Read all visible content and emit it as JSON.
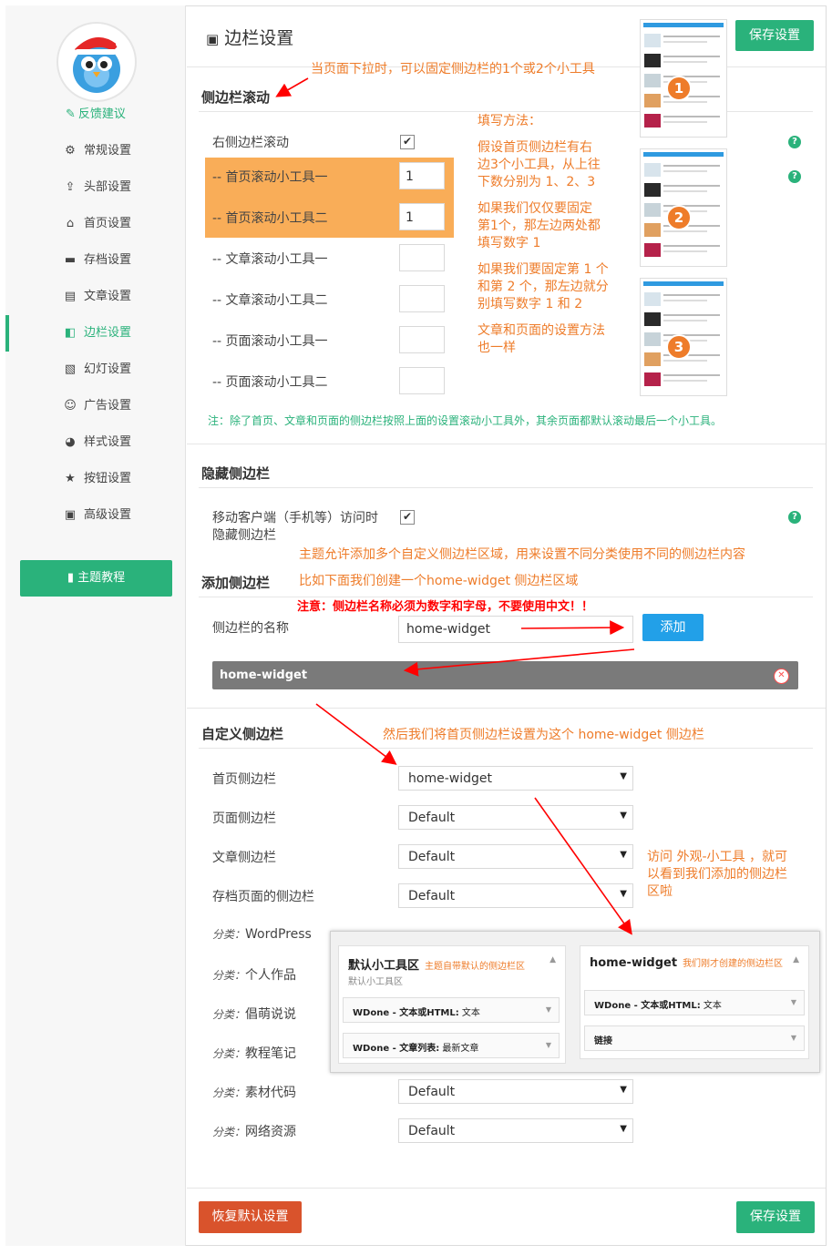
{
  "sidebar": {
    "feedback": "反馈建议",
    "items": [
      {
        "label": "常规设置",
        "icon": "gear-icon",
        "glyph": "⚙"
      },
      {
        "label": "头部设置",
        "icon": "upload-icon",
        "glyph": "⇪"
      },
      {
        "label": "首页设置",
        "icon": "home-icon",
        "glyph": "⌂"
      },
      {
        "label": "存档设置",
        "icon": "folder-icon",
        "glyph": "▬"
      },
      {
        "label": "文章设置",
        "icon": "article-icon",
        "glyph": "▤"
      },
      {
        "label": "边栏设置",
        "icon": "sidebar-icon",
        "glyph": "◧",
        "active": true
      },
      {
        "label": "幻灯设置",
        "icon": "picture-icon",
        "glyph": "▧"
      },
      {
        "label": "广告设置",
        "icon": "smile-icon",
        "glyph": "☺"
      },
      {
        "label": "样式设置",
        "icon": "palette-icon",
        "glyph": "◕"
      },
      {
        "label": "按钮设置",
        "icon": "star-icon",
        "glyph": "★"
      },
      {
        "label": "高级设置",
        "icon": "tools-icon",
        "glyph": "▣"
      }
    ],
    "tutorial": "主题教程"
  },
  "header": {
    "title": "边栏设置",
    "save_top": "保存设置"
  },
  "scroll": {
    "title": "侧边栏滚动",
    "right_label": "右侧边栏滚动",
    "rows": [
      {
        "label": "-- 首页滚动小工具一",
        "value": "1"
      },
      {
        "label": "-- 首页滚动小工具二",
        "value": "1"
      },
      {
        "label": "-- 文章滚动小工具一",
        "value": ""
      },
      {
        "label": "-- 文章滚动小工具二",
        "value": ""
      },
      {
        "label": "-- 页面滚动小工具一",
        "value": ""
      },
      {
        "label": "-- 页面滚动小工具二",
        "value": ""
      }
    ],
    "note": "注：除了首页、文章和页面的侧边栏按照上面的设置滚动小工具外，其余页面都默认滚动最后一个小工具。"
  },
  "hide": {
    "title": "隐藏侧边栏",
    "label_line1": "移动客户端（手机等）访问时",
    "label_line2": "隐藏侧边栏"
  },
  "add": {
    "title": "添加侧边栏",
    "name_label": "侧边栏的名称",
    "name_value": "home-widget",
    "add_button": "添加",
    "widget_name": "home-widget"
  },
  "custom": {
    "title": "自定义侧边栏",
    "rows": [
      {
        "label": "首页侧边栏",
        "value": "home-widget"
      },
      {
        "label": "页面侧边栏",
        "value": "Default"
      },
      {
        "label": "文章侧边栏",
        "value": "Default"
      },
      {
        "label": "存档页面的侧边栏",
        "value": "Default"
      }
    ],
    "cat_prefix": "分类：",
    "cats": [
      {
        "name": "WordPress",
        "value": ""
      },
      {
        "name": "个人作品",
        "value": ""
      },
      {
        "name": "倡萌说说",
        "value": ""
      },
      {
        "name": "教程笔记",
        "value": ""
      },
      {
        "name": "素材代码",
        "value": "Default"
      },
      {
        "name": "网络资源",
        "value": "Default"
      }
    ]
  },
  "footer": {
    "reset": "恢复默认设置",
    "save": "保存设置"
  },
  "annotations": {
    "a1": "当页面下拉时，可以固定侧边栏的1个或2个小工具",
    "fill_title": "填写方法：",
    "fill_p1": [
      "假设首页侧边栏有右",
      "边3个小工具，从上往",
      "下数分别为 1、2、3"
    ],
    "fill_p2": [
      "如果我们仅仅要固定",
      "第1个，那左边两处都",
      "填写数字 1"
    ],
    "fill_p3": [
      "如果我们要固定第 1 个",
      "和第 2 个，那左边就分",
      "别填写数字 1 和 2"
    ],
    "fill_p4": [
      "文章和页面的设置方法",
      "也一样"
    ],
    "a_multi": "主题允许添加多个自定义侧边栏区域，用来设置不同分类使用不同的侧边栏内容",
    "a_example": "比如下面我们创建一个home-widget 侧边栏区域",
    "a_warn": "注意：侧边栏名称必须为数字和字母，不要使用中文！！",
    "a_then": "然后我们将首页侧边栏设置为这个 home-widget 侧边栏",
    "a_visit": [
      "访问 外观-小工具 ，就可",
      "以看到我们添加的侧边栏",
      "区啦"
    ]
  },
  "thumbs": [
    "1",
    "2",
    "3"
  ],
  "popup": {
    "left_title": "默认小工具区",
    "left_note": "主题自带默认的侧边栏区",
    "left_sub": "默认小工具区",
    "left_items": [
      {
        "bold": "WDone - 文本或HTML:",
        "rest": " 文本"
      },
      {
        "bold": "WDone - 文章列表:",
        "rest": " 最新文章"
      }
    ],
    "right_title": "home-widget",
    "right_note": "我们刚才创建的侧边栏区",
    "right_items": [
      {
        "bold": "WDone - 文本或HTML:",
        "rest": " 文本"
      },
      {
        "bold": "链接",
        "rest": ""
      }
    ]
  },
  "colors": {
    "accent": "#2ab27b",
    "orange": "#ee7c2a",
    "blue": "#22a0e8",
    "red": "#d9532c"
  }
}
